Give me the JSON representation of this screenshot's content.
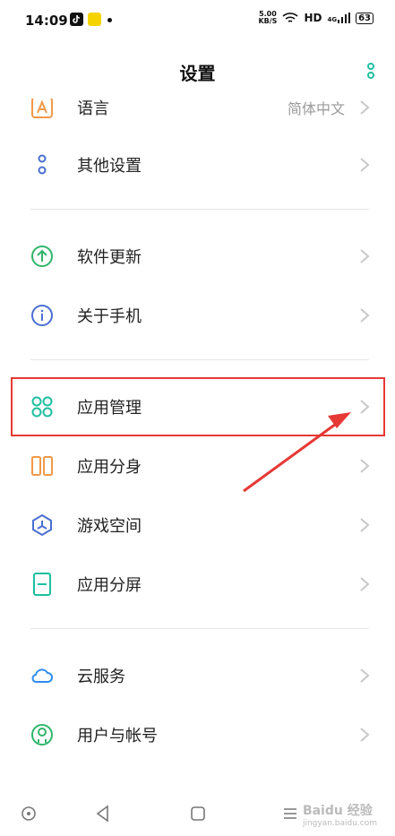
{
  "status_bar": {
    "time": "14:09",
    "speed_value": "5.00",
    "speed_unit": "KB/S",
    "hd": "HD",
    "network": "4G",
    "battery": "63"
  },
  "header": {
    "title": "设置"
  },
  "list": [
    {
      "label": "语言",
      "value": "简体中文",
      "icon": "language-icon"
    },
    {
      "label": "其他设置",
      "icon": "other-settings-icon"
    },
    {
      "label": "软件更新",
      "icon": "update-icon"
    },
    {
      "label": "关于手机",
      "icon": "info-icon"
    },
    {
      "label": "应用管理",
      "icon": "app-management-icon"
    },
    {
      "label": "应用分身",
      "icon": "app-clone-icon"
    },
    {
      "label": "游戏空间",
      "icon": "game-space-icon"
    },
    {
      "label": "应用分屏",
      "icon": "split-screen-icon"
    },
    {
      "label": "云服务",
      "icon": "cloud-icon"
    },
    {
      "label": "用户与帐号",
      "icon": "user-account-icon"
    }
  ],
  "colors": {
    "accent": "#1dbfa0",
    "highlight": "#e53935"
  },
  "watermark": {
    "brand": "Baidu 经验",
    "url": "jingyan.baidu.com"
  }
}
